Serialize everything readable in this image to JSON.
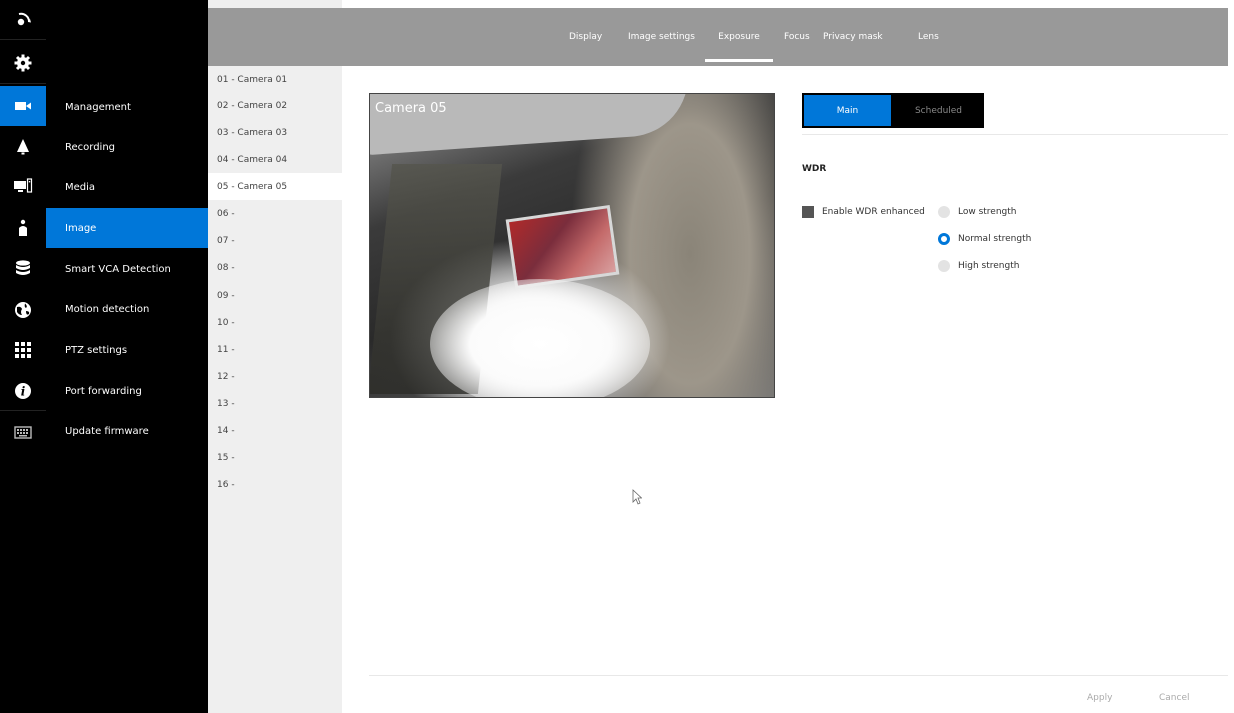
{
  "rail": {
    "items": [
      {
        "name": "live-view-icon"
      },
      {
        "name": "settings-gear-icon"
      },
      {
        "name": "camera-icon"
      },
      {
        "name": "alarm-bell-icon"
      },
      {
        "name": "display-devices-icon"
      },
      {
        "name": "user-icon"
      },
      {
        "name": "storage-database-icon"
      },
      {
        "name": "network-globe-icon"
      },
      {
        "name": "apps-grid-icon"
      },
      {
        "name": "info-icon"
      },
      {
        "name": "keyboard-icon"
      }
    ]
  },
  "menu": {
    "items": [
      {
        "label": "Management"
      },
      {
        "label": "Recording"
      },
      {
        "label": "Media"
      },
      {
        "label": "Image"
      },
      {
        "label": "Smart VCA Detection"
      },
      {
        "label": "Motion detection"
      },
      {
        "label": "PTZ settings"
      },
      {
        "label": "Port forwarding"
      },
      {
        "label": "Update firmware"
      }
    ],
    "active_index": 3
  },
  "cameras": {
    "items": [
      "01 - Camera 01",
      "02 - Camera 02",
      "03 - Camera 03",
      "04 - Camera 04",
      "05 - Camera 05",
      "06 -",
      "07 -",
      "08 -",
      "09 -",
      "10 -",
      "11 -",
      "12 -",
      "13 -",
      "14 -",
      "15 -",
      "16 -"
    ],
    "active_index": 4
  },
  "tabs": {
    "items": [
      "Display",
      "Image settings",
      "Exposure",
      "Focus",
      "Privacy mask",
      "Lens"
    ],
    "active_index": 2
  },
  "preview": {
    "camera_label": "Camera 05"
  },
  "mode": {
    "main_label": "Main",
    "scheduled_label": "Scheduled",
    "active": "Main"
  },
  "wdr": {
    "title": "WDR",
    "enable_label": "Enable WDR enhanced",
    "enabled": false,
    "options": [
      "Low strength",
      "Normal strength",
      "High strength"
    ],
    "selected": "Normal strength"
  },
  "footer": {
    "apply_label": "Apply",
    "cancel_label": "Cancel"
  },
  "colors": {
    "accent": "#0077d9",
    "sidebar_bg": "#000000",
    "topbar_bg": "#999999",
    "list_bg": "#efefef"
  }
}
